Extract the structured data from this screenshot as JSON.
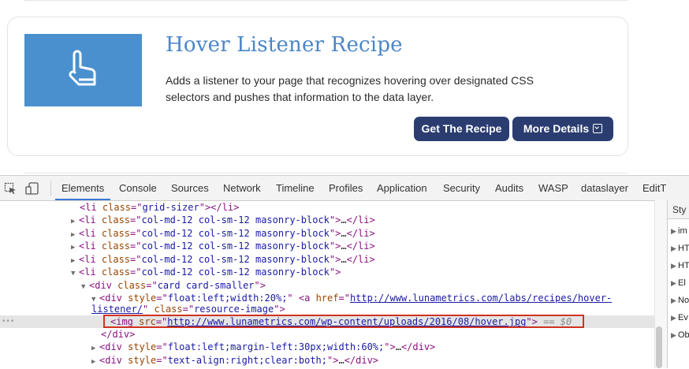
{
  "card": {
    "title": "Hover Listener Recipe",
    "description": "Adds a listener to your page that recognizes hovering over designated CSS selectors and pushes that information to the data layer.",
    "primary_button": "Get The Recipe",
    "secondary_button": "More Details",
    "thumbnail_icon": "hand-pointer-icon",
    "accent_color": "#4a90cf",
    "button_color": "#2b3d70"
  },
  "devtools": {
    "tabs": [
      "Elements",
      "Console",
      "Sources",
      "Network",
      "Timeline",
      "Profiles",
      "Application",
      "Security",
      "Audits",
      "WASP",
      "dataslayer",
      "EditThisC"
    ],
    "active_tab": "Elements",
    "dom": {
      "grid_sizer": {
        "tag": "li",
        "attr": "class",
        "value": "grid-sizer"
      },
      "masonry_class": "col-md-12 col-sm-12 masonry-block",
      "card_class": "card card-smaller",
      "div1_style": "float:left;width:20%;",
      "anchor_href": "http://www.lunametrics.com/labs/recipes/hover-",
      "anchor_href_cont": "listener/",
      "anchor_class": "resource-image",
      "img_src": "http://www.lunametrics.com/wp-content/uploads/2016/08/hover.jpg",
      "selected_marker": "== $0",
      "div2_style": "float:left;margin-left:30px;width:60%;",
      "div3_style": "text-align:right;clear:both;"
    },
    "styles_panel": {
      "header": "Sty",
      "items": [
        "im",
        "HT",
        "HT",
        "El",
        "No",
        "Ev",
        "Ob"
      ]
    }
  }
}
